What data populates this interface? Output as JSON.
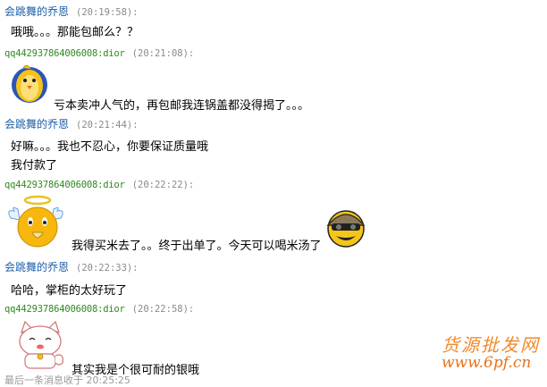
{
  "messages": [
    {
      "sender": "会跳舞的乔恩",
      "time": "(20:19:58):",
      "lines": [
        "哦哦。。。那能包邮么？？"
      ]
    },
    {
      "sender": "qq442937864006008:dior",
      "time": "(20:21:08):",
      "lines": [
        "亏本卖冲人气的，再包邮我连锅盖都没得揭了。。。"
      ],
      "emoticon": "yellow-chick-icon"
    },
    {
      "sender": "会跳舞的乔恩",
      "time": "(20:21:44):",
      "lines": [
        "好嘛。。。我也不忍心，你要保证质量哦",
        "我付款了"
      ]
    },
    {
      "sender": "qq442937864006008:dior",
      "time": "(20:22:22):",
      "lines": [
        "我得买米去了。。终于出单了。今天可以喝米汤了"
      ],
      "emoticon": "angel-praying-face-icon",
      "emoticon2": "helmet-face-icon"
    },
    {
      "sender": "会跳舞的乔恩",
      "time": "(20:22:33):",
      "lines": [
        "哈哈，掌柜的太好玩了"
      ]
    },
    {
      "sender": "qq442937864006008:dior",
      "time": "(20:22:58):",
      "lines": [
        "其实我是个很可耐的银哦"
      ],
      "emoticon": "lucky-cat-icon"
    }
  ],
  "footer": "最后一条消息收于 20:25:25",
  "watermark": {
    "line1": "货源批发网",
    "line2": "www.6pf.cn"
  },
  "colors": {
    "buyer_name": "#1a5fa8",
    "seller_name": "#2f8a1e",
    "time": "#8a8a8a",
    "watermark": "#f08a2c"
  }
}
